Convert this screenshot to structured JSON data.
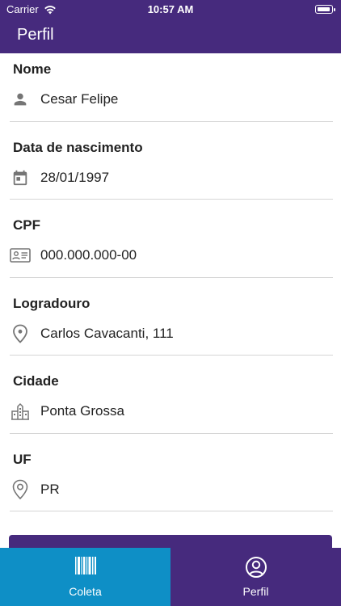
{
  "status_bar": {
    "carrier": "Carrier",
    "time": "10:57 AM"
  },
  "header": {
    "title": "Perfil"
  },
  "fields": [
    {
      "label": "Nome",
      "value": "Cesar Felipe",
      "icon": "person-icon"
    },
    {
      "label": "Data de nascimento",
      "value": "28/01/1997",
      "icon": "calendar-icon"
    },
    {
      "label": "CPF",
      "value": "000.000.000-00",
      "icon": "id-card-icon"
    },
    {
      "label": "Logradouro",
      "value": "Carlos Cavacanti, 111",
      "icon": "location-pin-icon"
    },
    {
      "label": "Cidade",
      "value": "Ponta Grossa",
      "icon": "city-icon"
    },
    {
      "label": "UF",
      "value": "PR",
      "icon": "location-pin-outline-icon"
    }
  ],
  "tabs": [
    {
      "label": "Coleta",
      "icon": "barcode-icon",
      "active": false
    },
    {
      "label": "Perfil",
      "icon": "account-circle-icon",
      "active": true
    }
  ],
  "colors": {
    "primary": "#462a7d",
    "tab_coleta": "#0e8fc6",
    "divider": "#d6d6d6",
    "icon": "#757575"
  }
}
